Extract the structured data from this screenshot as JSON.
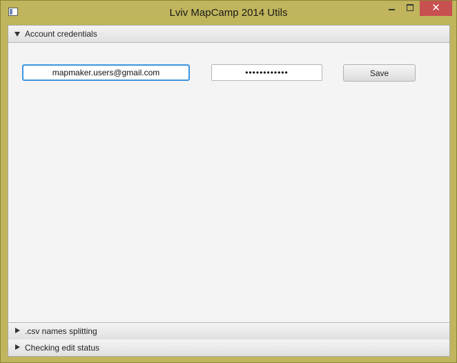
{
  "window": {
    "title": "Lviv MapCamp 2014 Utils",
    "controls": {
      "minimize_icon": "minimize-icon",
      "maximize_icon": "maximize-icon",
      "close_label": "✕"
    }
  },
  "panes": [
    {
      "label": "Account credentials",
      "expanded": true
    },
    {
      "label": ".csv names splitting",
      "expanded": false
    },
    {
      "label": "Checking edit status",
      "expanded": false
    }
  ],
  "account": {
    "email_value": "mapmaker.users@gmail.com",
    "password_value": "••••••••••••",
    "save_label": "Save"
  },
  "colors": {
    "window_frame": "#c0b55c",
    "focus_border": "#3d94e0",
    "close_button": "#c75050"
  }
}
